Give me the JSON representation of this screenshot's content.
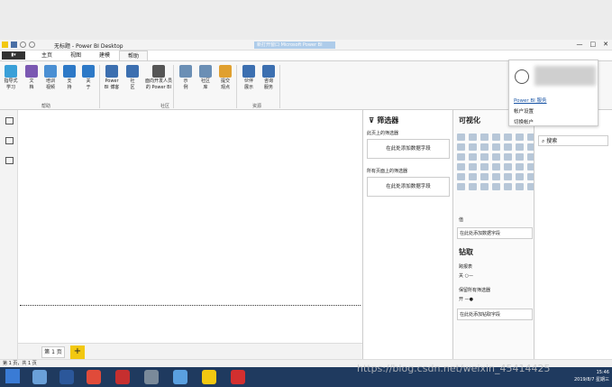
{
  "window": {
    "title": "无标题 - Power BI Desktop",
    "ghost_tab": "新打开窗口 Microsoft Power BI",
    "min": "—",
    "max": "□",
    "close": "✕"
  },
  "menu": {
    "file": "▮▾",
    "tabs": [
      "主页",
      "视图",
      "建模",
      "帮助"
    ],
    "active": 3
  },
  "ribbon": {
    "buttons": [
      {
        "label": "指导式\n学习",
        "color": "#3aa0d8"
      },
      {
        "label": "文\n档",
        "color": "#7b58b2"
      },
      {
        "label": "培训\n视频",
        "color": "#4a8fd3"
      },
      {
        "label": "支\n持",
        "color": "#2d79c7"
      },
      {
        "label": "关\n于",
        "color": "#2d79c7"
      },
      {
        "label": "Power\nBI 博客",
        "color": "#3c6fb0"
      },
      {
        "label": "社\n区",
        "color": "#3c6fb0"
      },
      {
        "label": "面向开发人员\n的 Power BI",
        "color": "#555555"
      },
      {
        "label": "示\n例",
        "color": "#6b8fb5"
      },
      {
        "label": "社区\n库",
        "color": "#6b8fb5"
      },
      {
        "label": "提交\n观点",
        "color": "#e0a030"
      },
      {
        "label": "伙伴\n展示",
        "color": "#3c6fb0"
      },
      {
        "label": "咨询\n服务",
        "color": "#3c6fb0"
      }
    ],
    "groups": [
      "帮助",
      "社区",
      "资源"
    ]
  },
  "canvas": {
    "page_tab": "第 1 页",
    "add_page": "+"
  },
  "filters": {
    "title": "筛选器",
    "this_page": "此页上的筛选器",
    "all_pages": "所有页面上的筛选器",
    "drop_hint": "在此处添加数据字段"
  },
  "viz": {
    "title": "可视化",
    "values_label": "值",
    "values_hint": "在此处添加数据字段",
    "drillthrough": "钻取",
    "cross_report": "跨报表",
    "cross_report_state": "关",
    "keep_filters": "保留所有筛选器",
    "keep_filters_state": "开",
    "drill_hint": "在此处添加钻取字段"
  },
  "fields": {
    "search_placeholder": "搜索"
  },
  "account": {
    "links": [
      "Power BI 服务",
      "帐户设置",
      "切换帐户"
    ]
  },
  "status": {
    "text": "第 1 页，共 1 页"
  },
  "taskbar": {
    "time": "15:46",
    "date": "2019/8/7 星期三"
  },
  "watermark": "https://blog.csdn.net/weixin_45414425"
}
